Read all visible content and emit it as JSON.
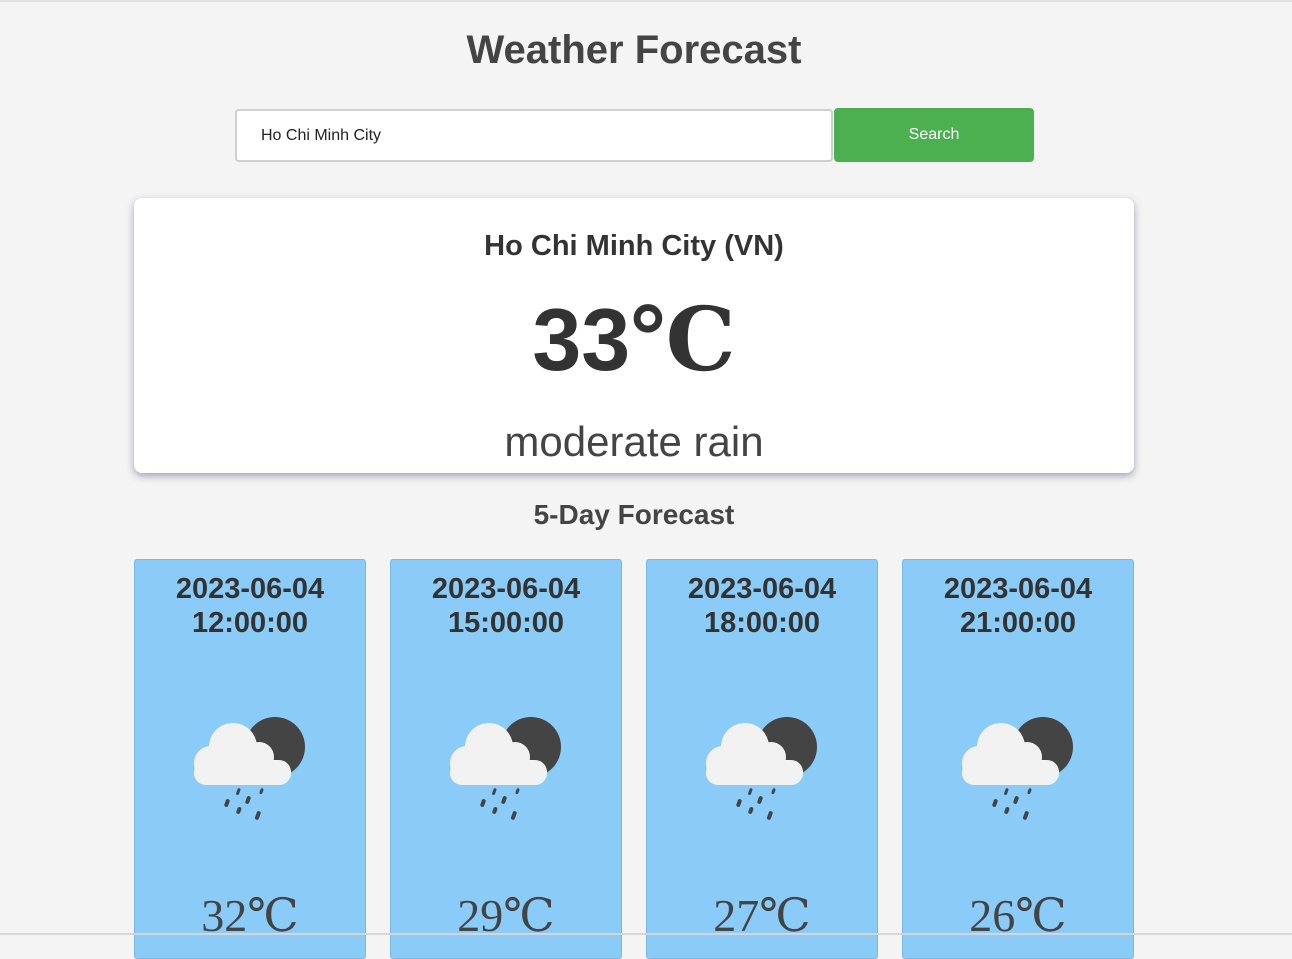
{
  "header": {
    "title": "Weather Forecast"
  },
  "search": {
    "value": "Ho Chi Minh City",
    "button_label": "Search"
  },
  "current": {
    "city": "Ho Chi Minh City (VN)",
    "temp_value": "33",
    "temp_unit": "℃",
    "description": "moderate rain"
  },
  "forecast": {
    "heading": "5-Day Forecast",
    "icon": "rain-cloud-moon-icon",
    "items": [
      {
        "date": "2023-06-04",
        "time": "12:00:00",
        "temp": "32℃"
      },
      {
        "date": "2023-06-04",
        "time": "15:00:00",
        "temp": "29℃"
      },
      {
        "date": "2023-06-04",
        "time": "18:00:00",
        "temp": "27℃"
      },
      {
        "date": "2023-06-04",
        "time": "21:00:00",
        "temp": "26℃"
      }
    ]
  },
  "colors": {
    "background": "#f4f4f4",
    "accent": "#4caf50",
    "forecast_card": "#8acbf8",
    "text": "#333333"
  }
}
